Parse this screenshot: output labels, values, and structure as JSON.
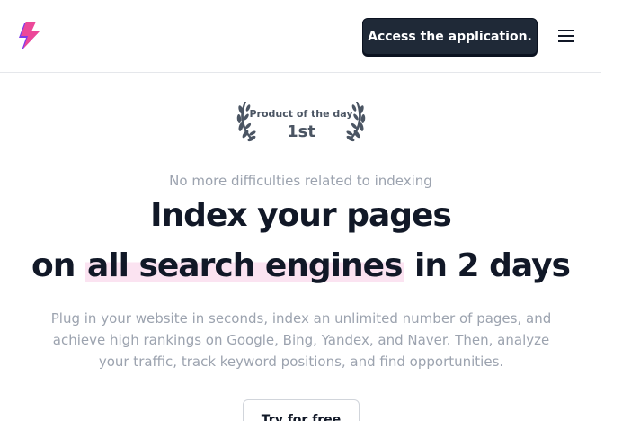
{
  "header": {
    "logo_icon": "lightning-bolt-icon",
    "cta_label": "Access the application.",
    "menu_icon": "hamburger-menu-icon"
  },
  "badge": {
    "title": "Product of the day",
    "rank": "1st",
    "icon": "laurel-wreath-icon"
  },
  "hero": {
    "eyebrow": "No more difficulties related to indexing",
    "headline_line1": "Index your pages",
    "headline_line2_prefix": "on",
    "headline_highlight": "all search engines",
    "headline_line2_suffix": "in 2 days",
    "description": "Plug in your website in seconds, index an unlimited number of pages, and achieve high rankings on Google, Bing, Yandex, and Naver. Then, analyze your traffic, track keyword positions, and find opportunities.",
    "cta_label": "Try for free"
  },
  "colors": {
    "primary_button": "#1f2937",
    "logo_pink": "#ec4899",
    "logo_purple": "#7c3aed",
    "highlight": "#fbe3f1",
    "muted_text": "#9ca3af"
  }
}
